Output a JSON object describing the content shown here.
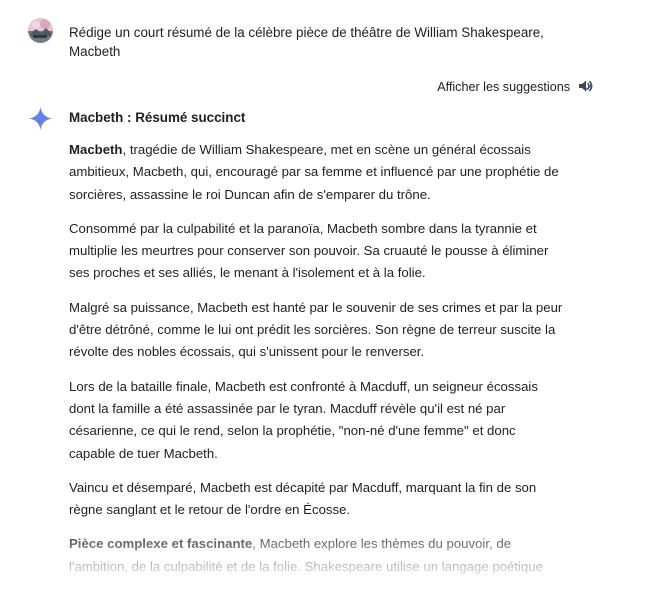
{
  "user_prompt": {
    "text": "Rédige un court résumé de la célèbre pièce de théâtre de William Shakespeare, Macbeth"
  },
  "toolbar": {
    "suggestions_label": "Afficher les suggestions"
  },
  "icons": {
    "chevron": "chevron-down-icon",
    "speaker": "speaker-icon",
    "assistant": "sparkle-icon"
  },
  "colors": {
    "accent_blue": "#4a7ee8",
    "text": "#1f1f1f"
  },
  "response": {
    "title": "Macbeth : Résumé succinct",
    "paragraphs": [
      {
        "bold": "Macbeth",
        "text": ", tragédie de William Shakespeare, met en scène un général écossais ambitieux, Macbeth, qui, encouragé par sa femme et influencé par une prophétie de sorcières, assassine le roi Duncan afin de s'emparer du trône."
      },
      {
        "bold": "",
        "text": "Consommé par la culpabilité et la paranoïa, Macbeth sombre dans la tyrannie et multiplie les meurtres pour conserver son pouvoir. Sa cruauté le pousse à éliminer ses proches et ses alliés, le menant à l'isolement et à la folie."
      },
      {
        "bold": "",
        "text": "Malgré sa puissance, Macbeth est hanté par le souvenir de ses crimes et par la peur d'être détrôné, comme le lui ont prédit les sorcières. Son règne de terreur suscite la révolte des nobles écossais, qui s'unissent pour le renverser."
      },
      {
        "bold": "",
        "text": "Lors de la bataille finale, Macbeth est confronté à Macduff, un seigneur écossais dont la famille a été assassinée par le tyran. Macduff révèle qu'il est né par césarienne, ce qui le rend, selon la prophétie, \"non-né d'une femme\" et donc capable de tuer Macbeth."
      },
      {
        "bold": "",
        "text": "Vaincu et désemparé, Macbeth est décapité par Macduff, marquant la fin de son règne sanglant et le retour de l'ordre en Écosse."
      },
      {
        "bold": "Pièce complexe et fascinante",
        "text": ", Macbeth explore les thèmes du pouvoir, de l'ambition, de la culpabilité et de la folie. Shakespeare utilise un langage poétique"
      }
    ]
  }
}
